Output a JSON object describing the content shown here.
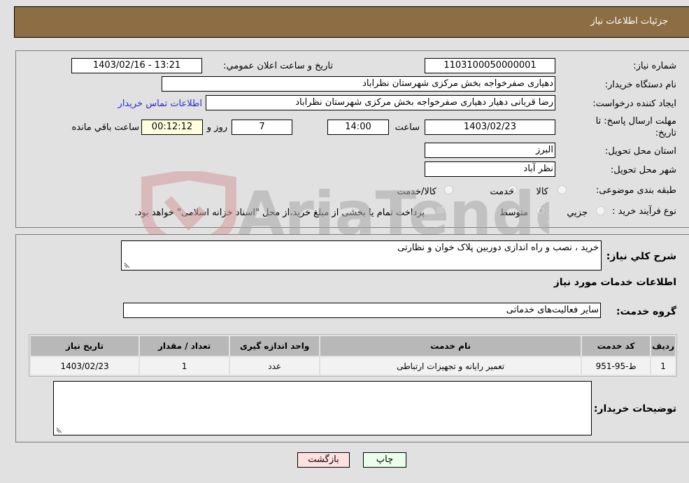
{
  "header": {
    "title": "جزئیات اطلاعات نیاز"
  },
  "fields": {
    "need_number_label": "شماره نیاز:",
    "need_number": "1103100050000001",
    "announce_label": "تاریخ و ساعت اعلان عمومي:",
    "announce_value": "1403/02/16 - 13:21",
    "buyer_org_label": "نام دستگاه خریدار:",
    "buyer_org": "دهیاری صفرخواجه بخش مرکزی شهرستان نظراباد",
    "creator_label": "ایجاد کننده درخواست:",
    "creator": "رضا قربانی دهیار دهیاری صفرخواجه بخش مرکزی شهرستان نظراباد",
    "contact_link": "اطلاعات تماس خریدار",
    "deadline_label": "مهلت ارسال پاسخ: تا تاریخ:",
    "deadline_date": "1403/02/23",
    "time_label": "ساعت",
    "deadline_time": "14:00",
    "days": "7",
    "days_suffix": "روز و",
    "remaining_time": "00:12:12",
    "remaining_label": "ساعت باقي مانده",
    "province_label": "استان محل تحویل:",
    "province": "البرز",
    "city_label": "شهر محل تحویل:",
    "city": "نظر آباد",
    "category_label": "طبقه بندی موضوعی:",
    "category_options": [
      {
        "label": "کالا",
        "checked": false
      },
      {
        "label": "خدمت",
        "checked": true
      },
      {
        "label": "کالا/خدمت",
        "checked": false
      }
    ],
    "process_label": "نوع فرآیند خرید :",
    "process_options": [
      {
        "label": "جزيي",
        "checked": false
      },
      {
        "label": "متوسط",
        "checked": true
      }
    ],
    "payment_note": "پرداخت تمام یا بخشی از مبلغ خرید،از محل \"اسناد خزانه اسلامی\" خواهد بود."
  },
  "details": {
    "general_desc_label": "شرح کلي نیاز:",
    "general_desc": "خرید ، نصب و راه اندازی دوربین پلاک خوان و نظارتی",
    "services_title": "اطلاعات خدمات مورد نیاز",
    "service_group_label": "گروه خدمت:",
    "service_group": "سایر فعالیت‌های خدماتی",
    "table": {
      "headers": [
        "ردیف",
        "کد خدمت",
        "نام خدمت",
        "واحد اندازه گیری",
        "تعداد / مقدار",
        "تاریخ نیاز"
      ],
      "rows": [
        [
          "1",
          "ط-95-951",
          "تعمیر رایانه و تجهیزات ارتباطی",
          "عدد",
          "1",
          "1403/02/23"
        ]
      ]
    },
    "buyer_notes_label": "توضیحات خریدار:",
    "buyer_notes": ""
  },
  "buttons": {
    "print": "چاپ",
    "back": "بازگشت"
  },
  "watermark": {
    "text": "AriaTender.neT"
  },
  "colors": {
    "header_bg": "#8c6d44",
    "print_bg": "#eaffea",
    "back_bg": "#ffe0e0",
    "yellow_box": "#ffffe0"
  }
}
